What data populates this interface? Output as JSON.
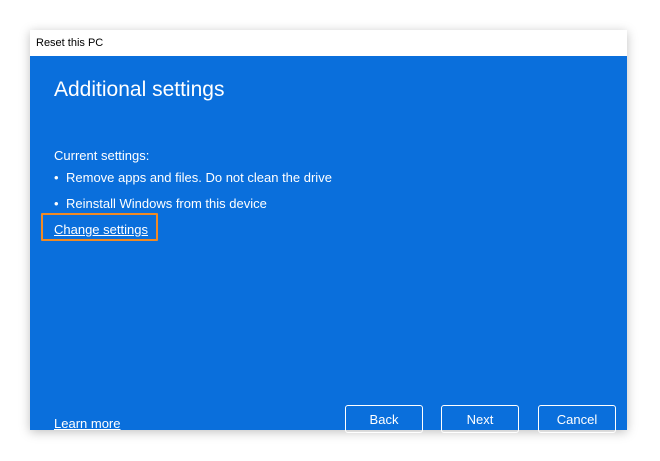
{
  "window": {
    "title": "Reset this PC"
  },
  "page": {
    "heading": "Additional settings",
    "current_label": "Current settings:",
    "bullets": [
      "Remove apps and files. Do not clean the drive",
      "Reinstall Windows from this device"
    ],
    "bullet_char": "•",
    "change_link": "Change settings",
    "learn_more": "Learn more"
  },
  "buttons": {
    "back": "Back",
    "next": "Next",
    "cancel": "Cancel"
  },
  "colors": {
    "background": "#0a6fdc",
    "highlight": "#f08a24",
    "text": "#ffffff"
  }
}
